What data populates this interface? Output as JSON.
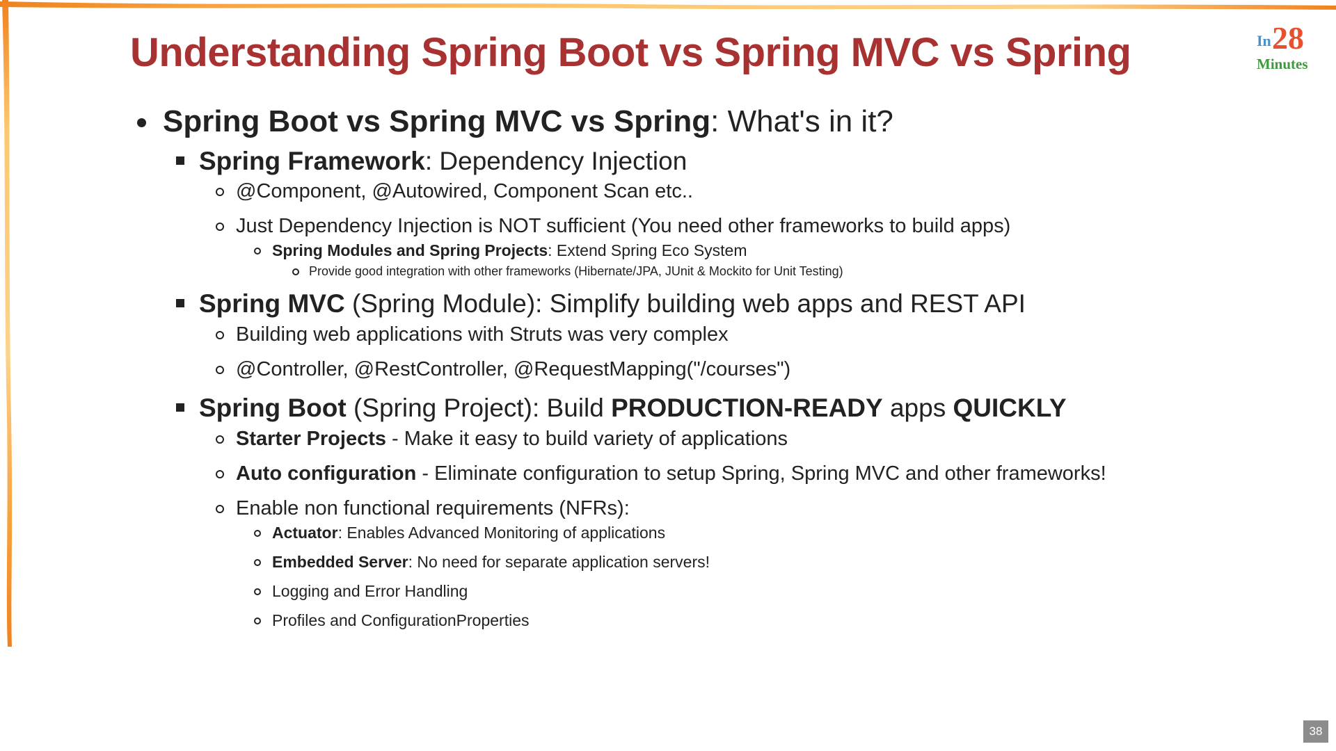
{
  "slide": {
    "title": "Understanding Spring Boot vs Spring MVC vs Spring",
    "page_number": "38",
    "logo": {
      "prefix": "In",
      "number": "28",
      "word": "Minutes"
    }
  },
  "bullets": {
    "main": {
      "bold": "Spring Boot vs Spring MVC vs Spring",
      "rest": ": What's in it?"
    },
    "framework": {
      "bold": "Spring Framework",
      "rest": ": Dependency Injection",
      "items": [
        "@Component, @Autowired, Component Scan etc..",
        "Just Dependency Injection is NOT sufficient (You need other frameworks to build apps)"
      ],
      "modules": {
        "bold": "Spring Modules and Spring Projects",
        "rest": ": Extend Spring Eco System",
        "sub": "Provide good integration with other frameworks (Hibernate/JPA, JUnit & Mockito for Unit Testing)"
      }
    },
    "mvc": {
      "bold": "Spring MVC",
      "rest": " (Spring Module): Simplify building web apps and REST API",
      "items": [
        "Building web applications with Struts was very complex",
        "@Controller, @RestController, @RequestMapping(\"/courses\")"
      ]
    },
    "boot": {
      "bold": "Spring Boot",
      "rest_a": " (Spring Project): Build ",
      "bold_b": "PRODUCTION-READY",
      "rest_c": " apps ",
      "bold_d": "QUICKLY",
      "starter": {
        "bold": "Starter Projects",
        "rest": " - Make it easy to build variety of applications"
      },
      "autoconfig": {
        "bold": "Auto configuration",
        "rest": " - Eliminate configuration to setup Spring, Spring MVC and other frameworks!"
      },
      "nfr": "Enable non functional requirements (NFRs):",
      "nfr_items": {
        "actuator": {
          "bold": "Actuator",
          "rest": ": Enables Advanced Monitoring of applications"
        },
        "embedded": {
          "bold": "Embedded Server",
          "rest": ": No need for separate application servers!"
        },
        "logging": "Logging and Error Handling",
        "profiles": "Profiles and ConfigurationProperties"
      }
    }
  },
  "colors": {
    "title": "#a83232",
    "frame_orange": "#f0821e",
    "frame_yellow": "#fdc870",
    "text": "#222222"
  }
}
